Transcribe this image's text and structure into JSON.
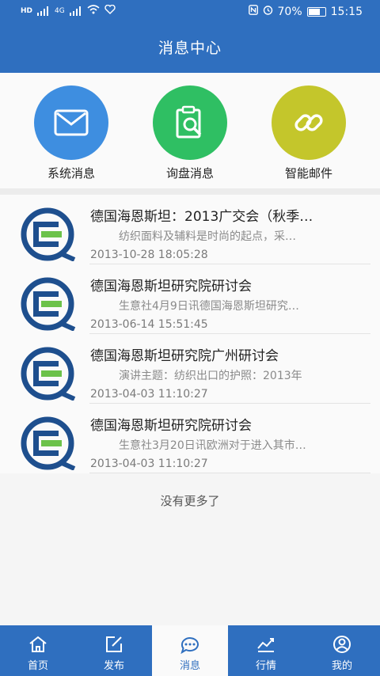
{
  "status_bar": {
    "battery": "70%",
    "time": "15:15",
    "network_left": "HD",
    "network_right": "4G"
  },
  "header": {
    "title": "消息中心"
  },
  "categories": [
    {
      "label": "系统消息",
      "color": "#3e8ee0",
      "icon": "envelope-icon"
    },
    {
      "label": "询盘消息",
      "color": "#2fbf63",
      "icon": "clipboard-search-icon"
    },
    {
      "label": "智能邮件",
      "color": "#c4c62b",
      "icon": "link-icon"
    }
  ],
  "messages": [
    {
      "title": "德国海恩斯坦：2013广交会（秋季…",
      "summary": "纺织面料及辅料是时尚的起点，采…",
      "time": "2013-10-28 18:05:28"
    },
    {
      "title": "德国海恩斯坦研究院研讨会",
      "summary": "生意社4月9日讯德国海恩斯坦研究…",
      "time": "2013-06-14 15:51:45"
    },
    {
      "title": "德国海恩斯坦研究院广州研讨会",
      "summary": "演讲主题：纺织出口的护照：2013年",
      "time": "2013-04-03 11:10:27"
    },
    {
      "title": "德国海恩斯坦研究院研讨会",
      "summary": "生意社3月20日讯欧洲对于进入其市…",
      "time": "2013-04-03 11:10:27"
    }
  ],
  "footer_text": "没有更多了",
  "nav": [
    {
      "label": "首页",
      "icon": "home-icon"
    },
    {
      "label": "发布",
      "icon": "edit-icon"
    },
    {
      "label": "消息",
      "icon": "chat-icon"
    },
    {
      "label": "行情",
      "icon": "chart-icon"
    },
    {
      "label": "我的",
      "icon": "user-icon"
    }
  ]
}
